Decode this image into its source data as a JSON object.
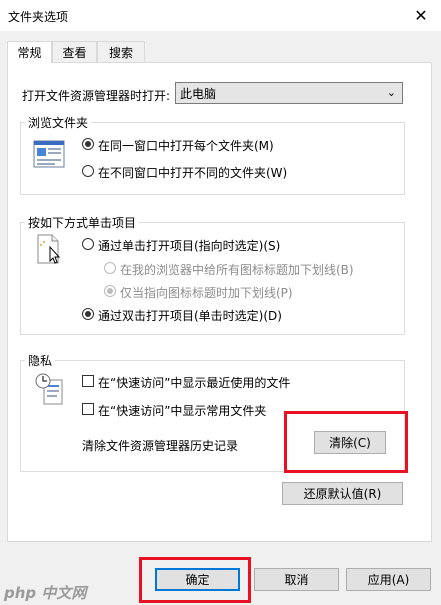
{
  "window": {
    "title": "文件夹选项"
  },
  "tabs": [
    {
      "label": "常规",
      "active": true
    },
    {
      "label": "查看",
      "active": false
    },
    {
      "label": "搜索",
      "active": false
    }
  ],
  "open_explorer": {
    "label": "打开文件资源管理器时打开:",
    "value": "此电脑"
  },
  "browse_folders": {
    "title": "浏览文件夹",
    "options": [
      {
        "label": "在同一窗口中打开每个文件夹(M)",
        "checked": true
      },
      {
        "label": "在不同窗口中打开不同的文件夹(W)",
        "checked": false
      }
    ]
  },
  "click_items": {
    "title": "按如下方式单击项目",
    "single_click": "通过单击打开项目(指向时选定)(S)",
    "underline_all": "在我的浏览器中给所有图标标题加下划线(B)",
    "underline_point": "仅当指向图标标题时加下划线(P)",
    "double_click": "通过双击打开项目(单击时选定)(D)"
  },
  "privacy": {
    "title": "隐私",
    "show_recent": "在“快速访问”中显示最近使用的文件",
    "show_frequent": "在“快速访问”中显示常用文件夹",
    "clear_history_label": "清除文件资源管理器历史记录",
    "clear_button": "清除(C)"
  },
  "restore_defaults": "还原默认值(R)",
  "footer": {
    "ok": "确定",
    "cancel": "取消",
    "apply": "应用(A)"
  },
  "watermark": "php 中文网",
  "colors": {
    "highlight": "#e81123",
    "accent": "#0078d7"
  }
}
